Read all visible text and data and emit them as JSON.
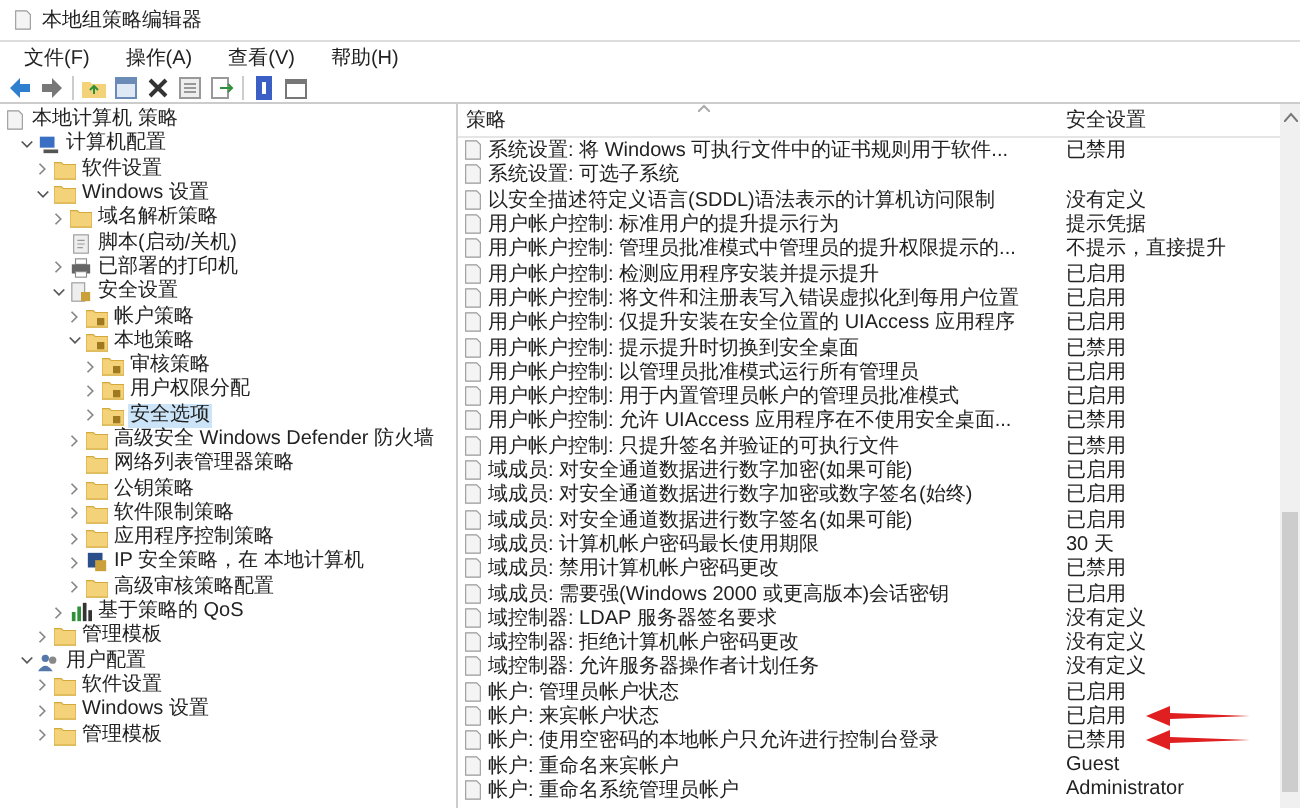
{
  "window": {
    "title": "本地组策略编辑器"
  },
  "menu": [
    "文件(F)",
    "操作(A)",
    "查看(V)",
    "帮助(H)"
  ],
  "tree": [
    {
      "label": "本地计算机 策略",
      "kind": "policy",
      "selected": false,
      "children": [
        {
          "label": "计算机配置",
          "kind": "computer",
          "expanded": true,
          "selected": false,
          "children": [
            {
              "label": "软件设置",
              "kind": "folder",
              "expanded": false,
              "selected": false
            },
            {
              "label": "Windows 设置",
              "kind": "folder",
              "expanded": true,
              "selected": false,
              "children": [
                {
                  "label": "域名解析策略",
                  "kind": "folder",
                  "expanded": false,
                  "selected": false
                },
                {
                  "label": "脚本(启动/关机)",
                  "kind": "script",
                  "selected": false
                },
                {
                  "label": "已部署的打印机",
                  "kind": "printer",
                  "expanded": false,
                  "selected": false
                },
                {
                  "label": "安全设置",
                  "kind": "security",
                  "expanded": true,
                  "selected": false,
                  "children": [
                    {
                      "label": "帐户策略",
                      "kind": "secfolder",
                      "expanded": false,
                      "selected": false
                    },
                    {
                      "label": "本地策略",
                      "kind": "secfolder",
                      "expanded": true,
                      "selected": false,
                      "children": [
                        {
                          "label": "审核策略",
                          "kind": "secfolder",
                          "expanded": false,
                          "selected": false
                        },
                        {
                          "label": "用户权限分配",
                          "kind": "secfolder",
                          "expanded": false,
                          "selected": false
                        },
                        {
                          "label": "安全选项",
                          "kind": "secfolder",
                          "expanded": false,
                          "selected": true
                        }
                      ]
                    },
                    {
                      "label": "高级安全 Windows Defender 防火墙",
                      "kind": "folder",
                      "expanded": false,
                      "selected": false
                    },
                    {
                      "label": "网络列表管理器策略",
                      "kind": "folder",
                      "selected": false
                    },
                    {
                      "label": "公钥策略",
                      "kind": "folder",
                      "expanded": false,
                      "selected": false
                    },
                    {
                      "label": "软件限制策略",
                      "kind": "folder",
                      "expanded": false,
                      "selected": false
                    },
                    {
                      "label": "应用程序控制策略",
                      "kind": "folder",
                      "expanded": false,
                      "selected": false
                    },
                    {
                      "label": "IP 安全策略，在 本地计算机",
                      "kind": "ip",
                      "expanded": false,
                      "selected": false
                    },
                    {
                      "label": "高级审核策略配置",
                      "kind": "folder",
                      "expanded": false,
                      "selected": false
                    }
                  ]
                },
                {
                  "label": "基于策略的 QoS",
                  "kind": "qos",
                  "expanded": false,
                  "selected": false
                }
              ]
            },
            {
              "label": "管理模板",
              "kind": "folder",
              "expanded": false,
              "selected": false
            }
          ]
        },
        {
          "label": "用户配置",
          "kind": "user",
          "expanded": true,
          "selected": false,
          "children": [
            {
              "label": "软件设置",
              "kind": "folder",
              "expanded": false,
              "selected": false
            },
            {
              "label": "Windows 设置",
              "kind": "folder",
              "expanded": false,
              "selected": false
            },
            {
              "label": "管理模板",
              "kind": "folder",
              "expanded": false,
              "selected": false
            }
          ]
        }
      ]
    }
  ],
  "table": {
    "columns": [
      "策略",
      "安全设置"
    ],
    "rows": [
      {
        "policy": "系统设置: 将 Windows 可执行文件中的证书规则用于软件...",
        "setting": "已禁用",
        "marked": false
      },
      {
        "policy": "系统设置: 可选子系统",
        "marked": false
      },
      {
        "policy": "以安全描述符定义语言(SDDL)语法表示的计算机访问限制",
        "setting": "没有定义",
        "marked": false
      },
      {
        "policy": "用户帐户控制: 标准用户的提升提示行为",
        "setting": "提示凭据",
        "marked": false
      },
      {
        "policy": "用户帐户控制: 管理员批准模式中管理员的提升权限提示的...",
        "setting": "不提示，直接提升",
        "marked": false
      },
      {
        "policy": "用户帐户控制: 检测应用程序安装并提示提升",
        "setting": "已启用",
        "marked": false
      },
      {
        "policy": "用户帐户控制: 将文件和注册表写入错误虚拟化到每用户位置",
        "setting": "已启用",
        "marked": false
      },
      {
        "policy": "用户帐户控制: 仅提升安装在安全位置的 UIAccess 应用程序",
        "setting": "已启用",
        "marked": false
      },
      {
        "policy": "用户帐户控制: 提示提升时切换到安全桌面",
        "setting": "已禁用",
        "marked": false
      },
      {
        "policy": "用户帐户控制: 以管理员批准模式运行所有管理员",
        "setting": "已启用",
        "marked": false
      },
      {
        "policy": "用户帐户控制: 用于内置管理员帐户的管理员批准模式",
        "setting": "已启用",
        "marked": false
      },
      {
        "policy": "用户帐户控制: 允许 UIAccess 应用程序在不使用安全桌面...",
        "setting": "已禁用",
        "marked": false
      },
      {
        "policy": "用户帐户控制: 只提升签名并验证的可执行文件",
        "setting": "已禁用",
        "marked": false
      },
      {
        "policy": "域成员: 对安全通道数据进行数字加密(如果可能)",
        "setting": "已启用",
        "marked": false
      },
      {
        "policy": "域成员: 对安全通道数据进行数字加密或数字签名(始终)",
        "setting": "已启用",
        "marked": false
      },
      {
        "policy": "域成员: 对安全通道数据进行数字签名(如果可能)",
        "setting": "已启用",
        "marked": false
      },
      {
        "policy": "域成员: 计算机帐户密码最长使用期限",
        "setting": "30 天",
        "marked": false
      },
      {
        "policy": "域成员: 禁用计算机帐户密码更改",
        "setting": "已禁用",
        "marked": false
      },
      {
        "policy": "域成员: 需要强(Windows 2000 或更高版本)会话密钥",
        "setting": "已启用",
        "marked": false
      },
      {
        "policy": "域控制器: LDAP 服务器签名要求",
        "setting": "没有定义",
        "marked": false
      },
      {
        "policy": "域控制器: 拒绝计算机帐户密码更改",
        "setting": "没有定义",
        "marked": false
      },
      {
        "policy": "域控制器: 允许服务器操作者计划任务",
        "setting": "没有定义",
        "marked": false
      },
      {
        "policy": "帐户: 管理员帐户状态",
        "setting": "已启用",
        "marked": false
      },
      {
        "policy": "帐户: 来宾帐户状态",
        "setting": "已启用",
        "marked": true
      },
      {
        "policy": "帐户: 使用空密码的本地帐户只允许进行控制台登录",
        "setting": "已禁用",
        "marked": true
      },
      {
        "policy": "帐户: 重命名来宾帐户",
        "setting": "Guest",
        "marked": false
      },
      {
        "policy": "帐户: 重命名系统管理员帐户",
        "setting": "Administrator",
        "marked": false
      }
    ]
  }
}
